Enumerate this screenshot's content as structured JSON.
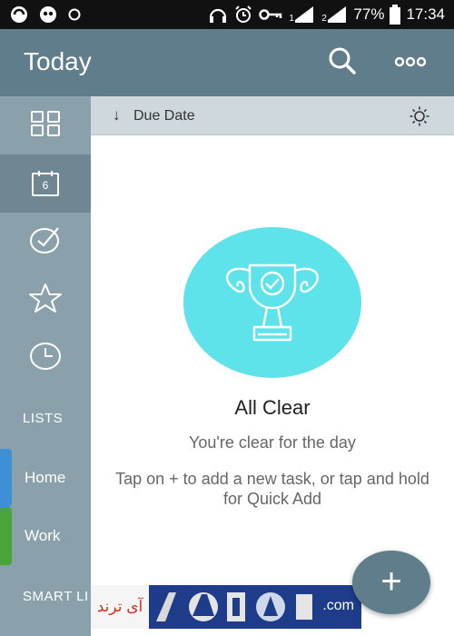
{
  "status_bar": {
    "battery": "77%",
    "time": "17:34",
    "sim1": "1",
    "sim2": "2",
    "icons": [
      "circle-app-icon",
      "owl-app-icon",
      "circle-icon",
      "headset-icon",
      "alarm-icon",
      "key-icon",
      "signal-sim1-icon",
      "signal-sim2-icon",
      "battery-icon"
    ]
  },
  "app_bar": {
    "title": "Today",
    "actions": [
      "search-icon",
      "more-icon"
    ]
  },
  "sidebar": {
    "calendar_day": "6",
    "nav": [
      "grid-icon",
      "calendar-icon",
      "check-circle-icon",
      "star-icon",
      "clock-icon"
    ],
    "lists_header": "LISTS",
    "lists": [
      {
        "label": "Home",
        "color": "#3d8fd6"
      },
      {
        "label": "Work",
        "color": "#49a53a"
      }
    ],
    "smart_lists_header": "SMART LI"
  },
  "sort_bar": {
    "label": "Due Date",
    "arrow": "↓",
    "icons": [
      "sort-arrow-icon",
      "brightness-icon"
    ]
  },
  "empty_state": {
    "title": "All Clear",
    "subtitle": "You're clear for the day",
    "hint": "Tap on + to add a new task, or tap and hold for Quick Add",
    "icon": "trophy-icon"
  },
  "fab": {
    "label": "+"
  },
  "watermark": {
    "left_text": "آی ترند",
    "right_text": ".com"
  },
  "colors": {
    "primary": "#607d8b",
    "sidebar": "#8aa1ab",
    "sidebar_active": "#6f8793",
    "sort_bar": "#cfd8dc",
    "accent_circle": "#5ee3ea"
  }
}
